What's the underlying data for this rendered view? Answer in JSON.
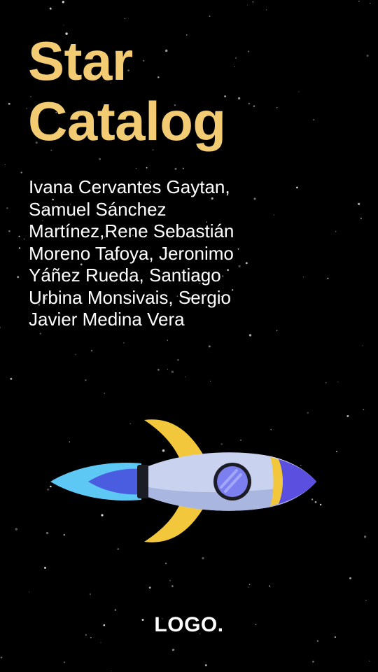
{
  "document": {
    "title": "Star\nCatalog",
    "authors": "Ivana Cervantes Gaytan,\nSamuel Sánchez\nMartínez,Rene Sebastián\nMoreno Tafoya, Jeronimo\nYáñez Rueda, Santiago\nUrbina Monsivais, Sergio\nJavier Medina Vera",
    "logo": "LOGO."
  },
  "illustration": {
    "name": "rocket",
    "colors": {
      "body": "#c9d3ef",
      "body_shadow": "#a9b6df",
      "fins": "#f2c73b",
      "nose": "#5b4fe0",
      "window": "#7b7ff0",
      "flame_outer": "#5ec8f5",
      "flame_inner": "#4a5ce0",
      "nozzle": "#1c1c24"
    }
  },
  "colors": {
    "background": "#000000",
    "title": "#f2cb72",
    "text": "#ffffff"
  }
}
